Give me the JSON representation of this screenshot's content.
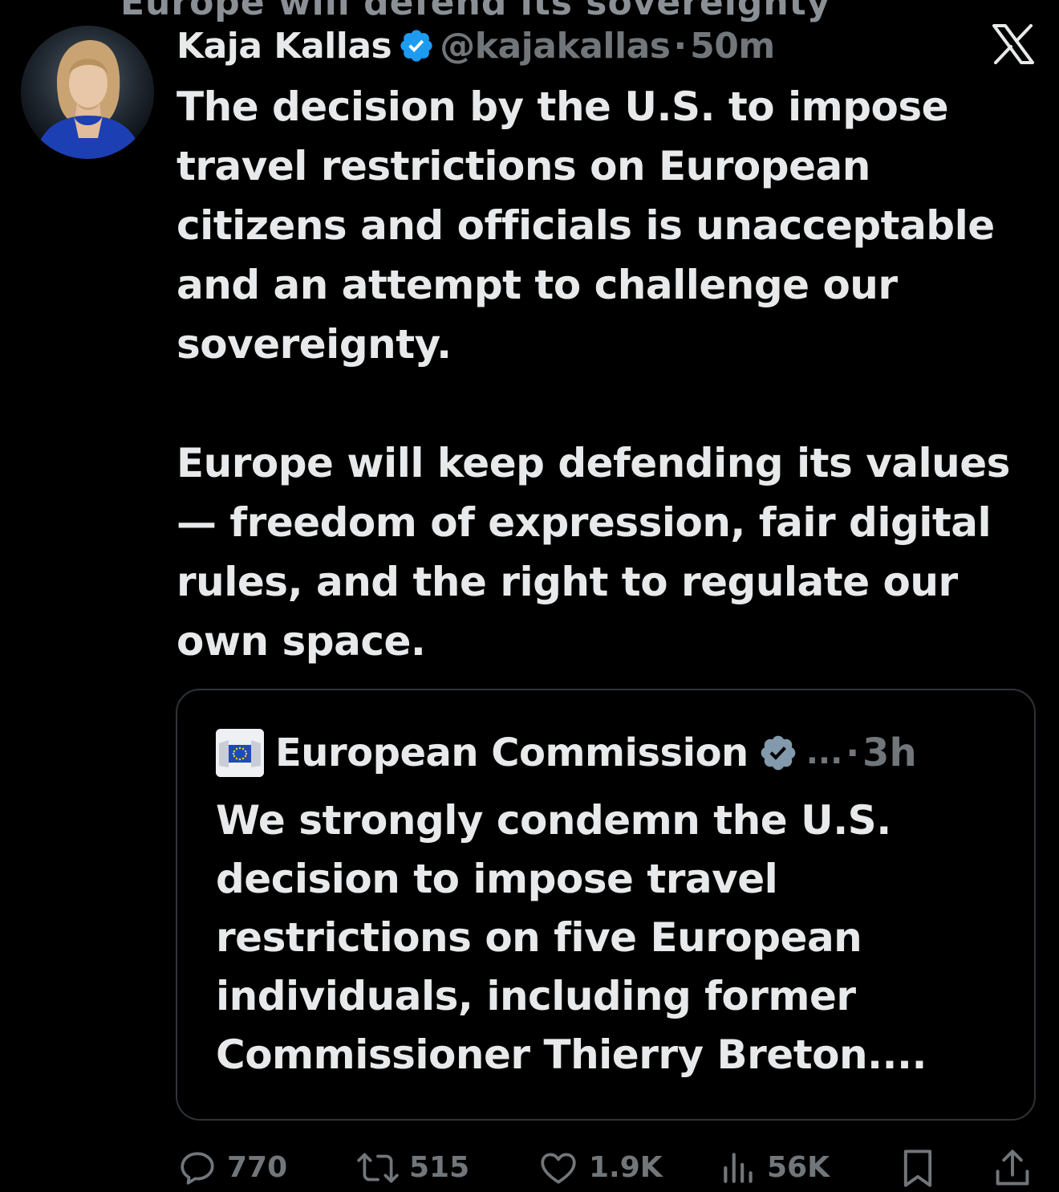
{
  "top_clipped_text": "Europe will defend its sovereignty",
  "tweet": {
    "author_name": "Kaja Kallas",
    "handle": "@kajakallas",
    "separator": "·",
    "time": "50m",
    "paragraphs": [
      "The decision by the U.S. to impose travel restrictions on European citizens and officials is unacceptable and an attempt to challenge our sovereignty.",
      "Europe will keep defending its values — freedom of expression, fair digital rules, and the right to regulate our own space."
    ]
  },
  "quote": {
    "author_name": "European Commission",
    "more": "...",
    "separator": "·",
    "time": "3h",
    "text": "We strongly condemn the U.S. decision to impose travel restrictions on five European individuals, including former Commissioner Thierry Breton...."
  },
  "actions": {
    "replies": "770",
    "reposts": "515",
    "likes": "1.9K",
    "views": "56K"
  },
  "icons": {
    "verified": "verified-badge-icon",
    "brand": "x-logo-icon",
    "reply": "reply-icon",
    "repost": "repost-icon",
    "like": "heart-icon",
    "views": "views-icon",
    "bookmark": "bookmark-icon",
    "share": "share-icon"
  },
  "colors": {
    "background": "#000000",
    "text": "#e7e9ea",
    "muted": "#71767b",
    "verified": "#1d9bf0",
    "border": "#2f3336"
  }
}
